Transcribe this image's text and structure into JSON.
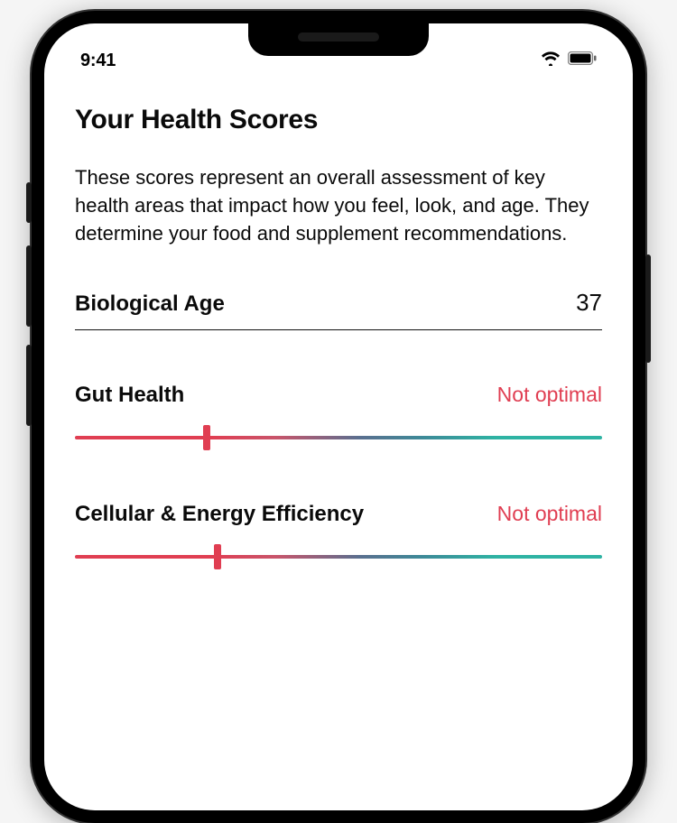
{
  "status_bar": {
    "time": "9:41"
  },
  "page": {
    "title": "Your Health Scores",
    "description": "These scores represent an overall assessment of key health areas that impact how you feel, look, and age. They determine your food and supplement recommendations."
  },
  "biological_age": {
    "label": "Biological Age",
    "value": "37"
  },
  "scores": [
    {
      "label": "Gut Health",
      "status": "Not optimal",
      "status_color": "#e03e52",
      "slider_position_pct": 25
    },
    {
      "label": "Cellular & Energy Efficiency",
      "status": "Not optimal",
      "status_color": "#e03e52",
      "slider_position_pct": 27
    }
  ]
}
